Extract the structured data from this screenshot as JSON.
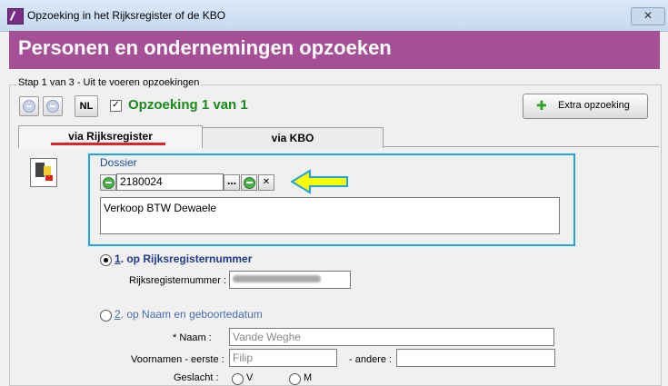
{
  "window": {
    "title": "Opzoeking in het Rijksregister of de KBO",
    "close_label": "✕"
  },
  "header": {
    "title": "Personen en ondernemingen opzoeken"
  },
  "step": {
    "label": "Stap 1 van 3 - Uit te voeren opzoekingen",
    "lang_button": "NL",
    "checkbox_checked": true,
    "count_text": "Opzoeking 1 van 1",
    "extra_button": "Extra opzoeking"
  },
  "tabs": [
    {
      "label": "via Rijksregister",
      "active": true
    },
    {
      "label": "via KBO",
      "active": false
    }
  ],
  "dossier": {
    "label": "Dossier",
    "number": "2180024",
    "dots_label": "…",
    "clear_label": "✕",
    "description": "Verkoop BTW Dewaele"
  },
  "option1": {
    "number": "1",
    "label": ". op Rijksregisternummer",
    "selected": true,
    "field_label": "Rijksregisternummer :"
  },
  "option2": {
    "number": "2",
    "label": ". op Naam en geboortedatum",
    "selected": false,
    "name_label": "* Naam :",
    "name_placeholder": "Vande Weghe",
    "first_label": "Voornamen - eerste :",
    "first_placeholder": "Filip",
    "other_label": "- andere :",
    "gender_label": "Geslacht :",
    "gender_m": "V",
    "gender_f": "M"
  },
  "colors": {
    "header_bg": "#a54f96",
    "highlight_border": "#1ea5e0",
    "arrow_fill": "#ffff00",
    "tab_underline": "#e0222a",
    "count_text": "#1a8a1a"
  }
}
